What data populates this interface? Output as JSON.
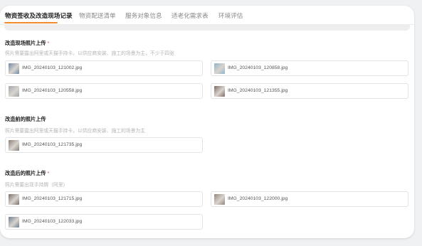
{
  "tabs": [
    {
      "label": "物资签收及改造现场记录",
      "active": true
    },
    {
      "label": "物资配送清单",
      "active": false
    },
    {
      "label": "服务对象信息",
      "active": false
    },
    {
      "label": "适老化需求表",
      "active": false
    },
    {
      "label": "环境评估",
      "active": false
    }
  ],
  "sections": [
    {
      "title": "改造现场照片上传",
      "required": "*",
      "hint": "照片需要露出阿里或天猫手持卡，以供应商安装、施工的场景为主，不少于四张",
      "files": [
        {
          "name": "IMG_20240103_121002.jpg",
          "thumb_color": "#6f8aa6"
        },
        {
          "name": "IMG_20240103_120858.jpg",
          "thumb_color": "#8fb4c8"
        },
        {
          "name": "IMG_20240103_120558.jpg",
          "thumb_color": "#a0a6a8"
        },
        {
          "name": "IMG_20240103_121355.jpg",
          "thumb_color": "#7d6a60"
        }
      ]
    },
    {
      "title": "改造前的照片上传",
      "required": "",
      "hint": "照片需要露出阿里或天猫手持卡，以供应商安装、施工的场景为主",
      "files": [
        {
          "name": "IMG_20240103_121735.jpg",
          "thumb_color": "#8a7f76"
        }
      ]
    },
    {
      "title": "改造后的照片上传",
      "required": "*",
      "hint": "照片需要出现手持牌（阿里）",
      "files": [
        {
          "name": "IMG_20240103_121715.jpg",
          "thumb_color": "#7b6f69"
        },
        {
          "name": "IMG_20240103_122000.jpg",
          "thumb_color": "#93857a"
        },
        {
          "name": "IMG_20240103_122033.jpg",
          "thumb_color": "#6d7f93"
        }
      ]
    }
  ],
  "colors": {
    "accent": "#f28c28",
    "required": "#e5484d"
  }
}
